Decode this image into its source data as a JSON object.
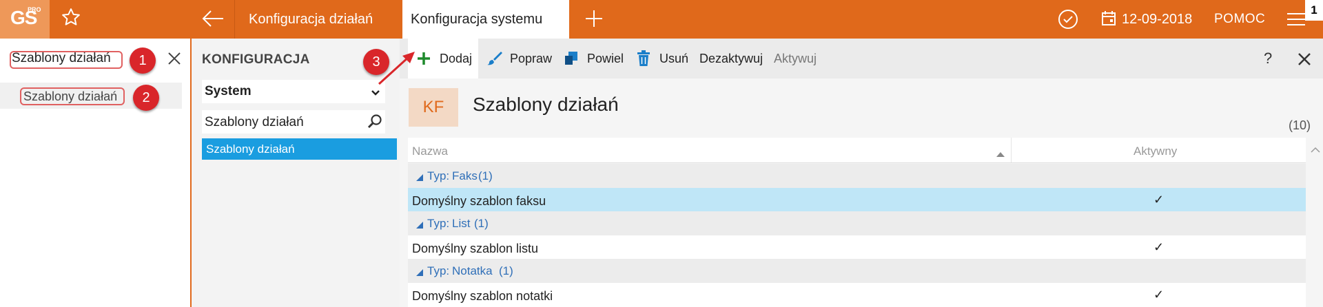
{
  "app": {
    "logo_text": "GS",
    "logo_sup": "PRO"
  },
  "tabs": [
    {
      "label": "Konfiguracja działań"
    },
    {
      "label": "Konfiguracja systemu"
    }
  ],
  "header": {
    "date": "12-09-2018",
    "help": "POMOC",
    "badge": "1"
  },
  "left": {
    "search_value": "Szablony działań",
    "result": "Szablony działań"
  },
  "callouts": [
    "1",
    "2",
    "3"
  ],
  "config": {
    "title": "KONFIGURACJA",
    "select_value": "System",
    "search_value": "Szablony działań",
    "selected_item": "Szablony działań"
  },
  "toolbar": {
    "add": "Dodaj",
    "edit": "Popraw",
    "duplicate": "Powiel",
    "delete": "Usuń",
    "deactivate": "Dezaktywuj",
    "activate": "Aktywuj",
    "help": "?"
  },
  "main": {
    "badge": "KF",
    "title": "Szablony działań",
    "count": "(10)",
    "col_name": "Nazwa",
    "col_active": "Aktywny",
    "groups": [
      {
        "type_label": "Typ:",
        "type_value": "Faks",
        "count": "(1)",
        "row": "Domyślny szablon faksu",
        "active": "✓"
      },
      {
        "type_label": "Typ:",
        "type_value": "List",
        "count": "(1)",
        "row": "Domyślny szablon listu",
        "active": "✓"
      },
      {
        "type_label": "Typ:",
        "type_value": "Notatka",
        "count": "(1)",
        "row": "Domyślny szablon notatki",
        "active": "✓"
      }
    ]
  },
  "colors": {
    "brand": "#e0691b",
    "selected": "#1a9de0",
    "callout": "#d9262a"
  }
}
